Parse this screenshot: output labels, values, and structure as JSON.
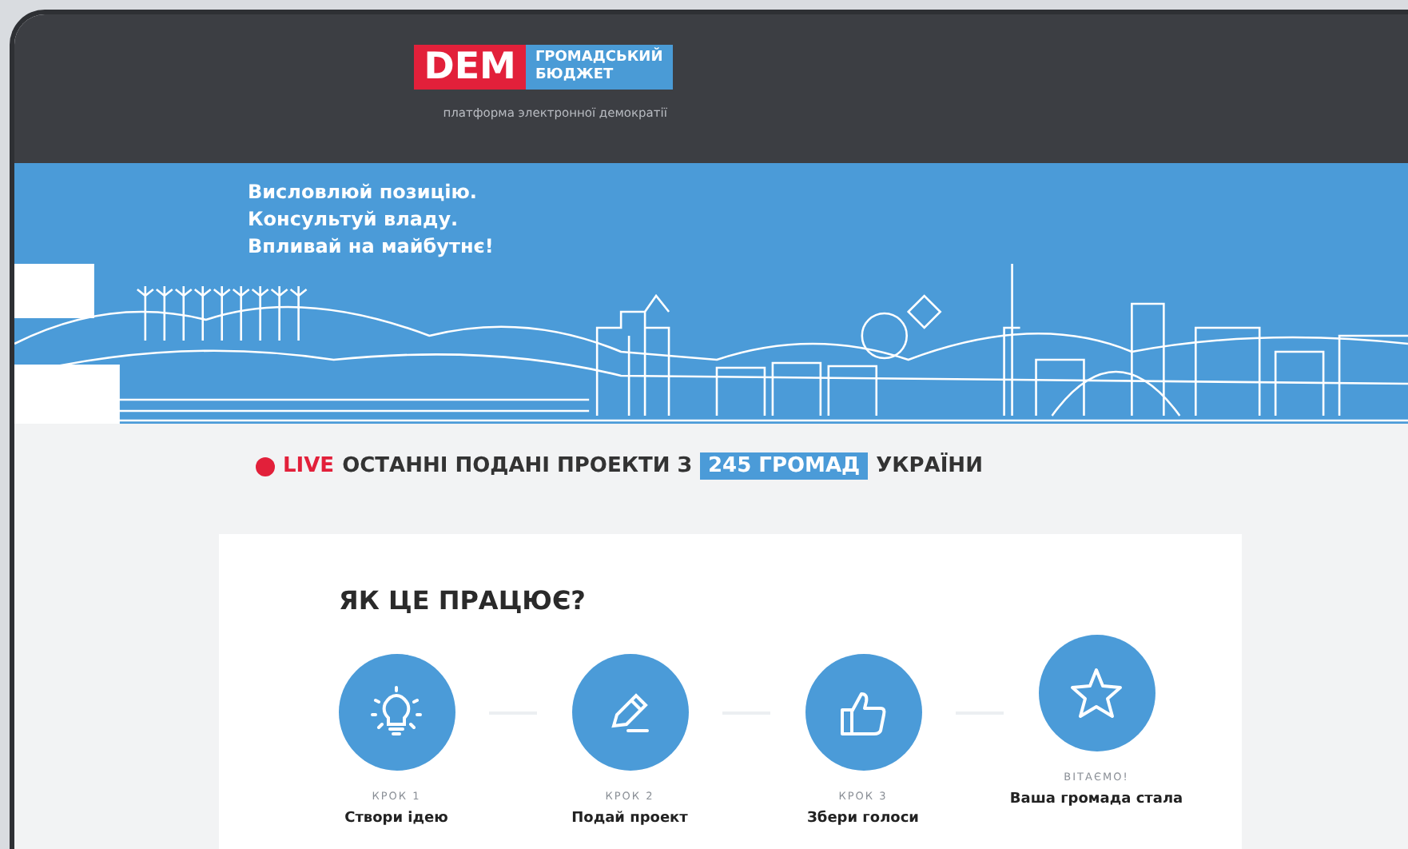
{
  "header": {
    "logo_mark": "DEM",
    "logo_title": [
      "ГРОМАДСЬКИЙ",
      "БЮДЖЕТ"
    ],
    "tagline": "платформа электронної демократії"
  },
  "banner": {
    "slogan": [
      "Висловлюй позицію.",
      "Консультуй владу.",
      "Впливай на майбутнє!"
    ]
  },
  "live": {
    "badge": "LIVE",
    "text": "ОСТАННІ ПОДАНІ ПРОЕКТИ З",
    "highlight": "245 ГРОМАД",
    "suffix": "УКРАЇНИ"
  },
  "how_it_works": {
    "title": "ЯК ЦЕ ПРАЦЮЄ?",
    "steps": [
      {
        "label": "КРОК 1",
        "text": "Створи ідею"
      },
      {
        "label": "КРОК 2",
        "text": "Подай проект"
      },
      {
        "label": "КРОК 3",
        "text": "Збери голоси"
      },
      {
        "label": "ВІТАЄМО!",
        "text": "Ваша громада стала"
      }
    ]
  }
}
